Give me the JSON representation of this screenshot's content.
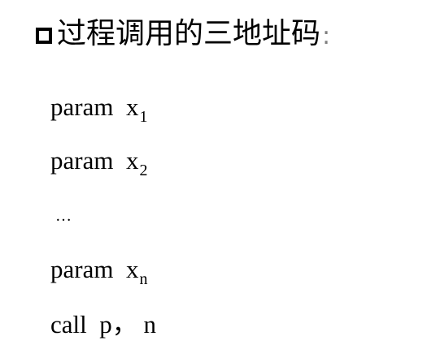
{
  "heading": {
    "bullet_icon": "hollow-square-bullet-icon",
    "title": "过程调用的三地址码",
    "colon": ":"
  },
  "code": {
    "lines": [
      {
        "keyword": "param",
        "var": "x",
        "sub": "1"
      },
      {
        "keyword": "param",
        "var": "x",
        "sub": "2"
      },
      {
        "keyword": "param",
        "var": "x",
        "sub": "n"
      }
    ],
    "ellipsis": "…",
    "call": "call  p， n"
  }
}
